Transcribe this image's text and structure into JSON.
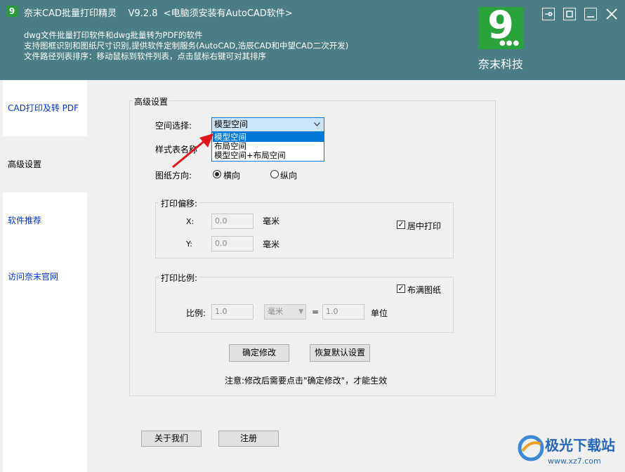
{
  "window": {
    "title": "奈末CAD批量打印精灵    V9.2.8  <电脑须安装有AutoCAD软件>",
    "desc_lines": [
      "dwg文件批量打印软件和dwg批量转为PDF的软件",
      "支持图框识别和图纸尺寸识别,提供软件定制服务(AutoCAD,浩辰CAD和中望CAD二次开发)",
      "文件路径列表排序：移动鼠标到软件列表，点击鼠标右键可对其排序"
    ],
    "logo_text": "奈末科技",
    "accent": "#4a7d85",
    "logo_color": "#2aa33b"
  },
  "sidebar": {
    "items": [
      {
        "label": "CAD打印及转 PDF"
      },
      {
        "label": "高级设置"
      },
      {
        "label": "软件推荐"
      },
      {
        "label": "访问奈末官网"
      }
    ],
    "active_index": 1
  },
  "settings": {
    "group_title": "高级设置",
    "space_label": "空间选择:",
    "space_selected": "模型空间",
    "space_options": [
      "模型空间",
      "布局空间",
      "模型空间+布局空间"
    ],
    "style_label": "样式表名称",
    "orientation_label": "图纸方向:",
    "orientation_options": [
      "横向",
      "纵向"
    ],
    "orientation_selected": "横向",
    "offset": {
      "title": "打印偏移:",
      "x_label": "X:",
      "x_value": "0.0",
      "y_label": "Y:",
      "y_value": "0.0",
      "unit": "毫米",
      "center_label": "居中打印",
      "center_checked": true
    },
    "scale": {
      "title": "打印比例:",
      "fill_label": "布满图纸",
      "fill_checked": true,
      "ratio_label": "比例:",
      "left_value": "1.0",
      "unit_select": "毫米",
      "equals": "=",
      "right_value": "1.0",
      "unit_label": "单位"
    },
    "confirm_button": "确定修改",
    "reset_button": "恢复默认设置",
    "note": "注意:修改后需要点击\"确定修改\"，才能生效"
  },
  "footer": {
    "about_button": "关于我们",
    "register_button": "注册"
  },
  "watermark": {
    "name": "极光下载站",
    "url": "www.xz7.com"
  }
}
